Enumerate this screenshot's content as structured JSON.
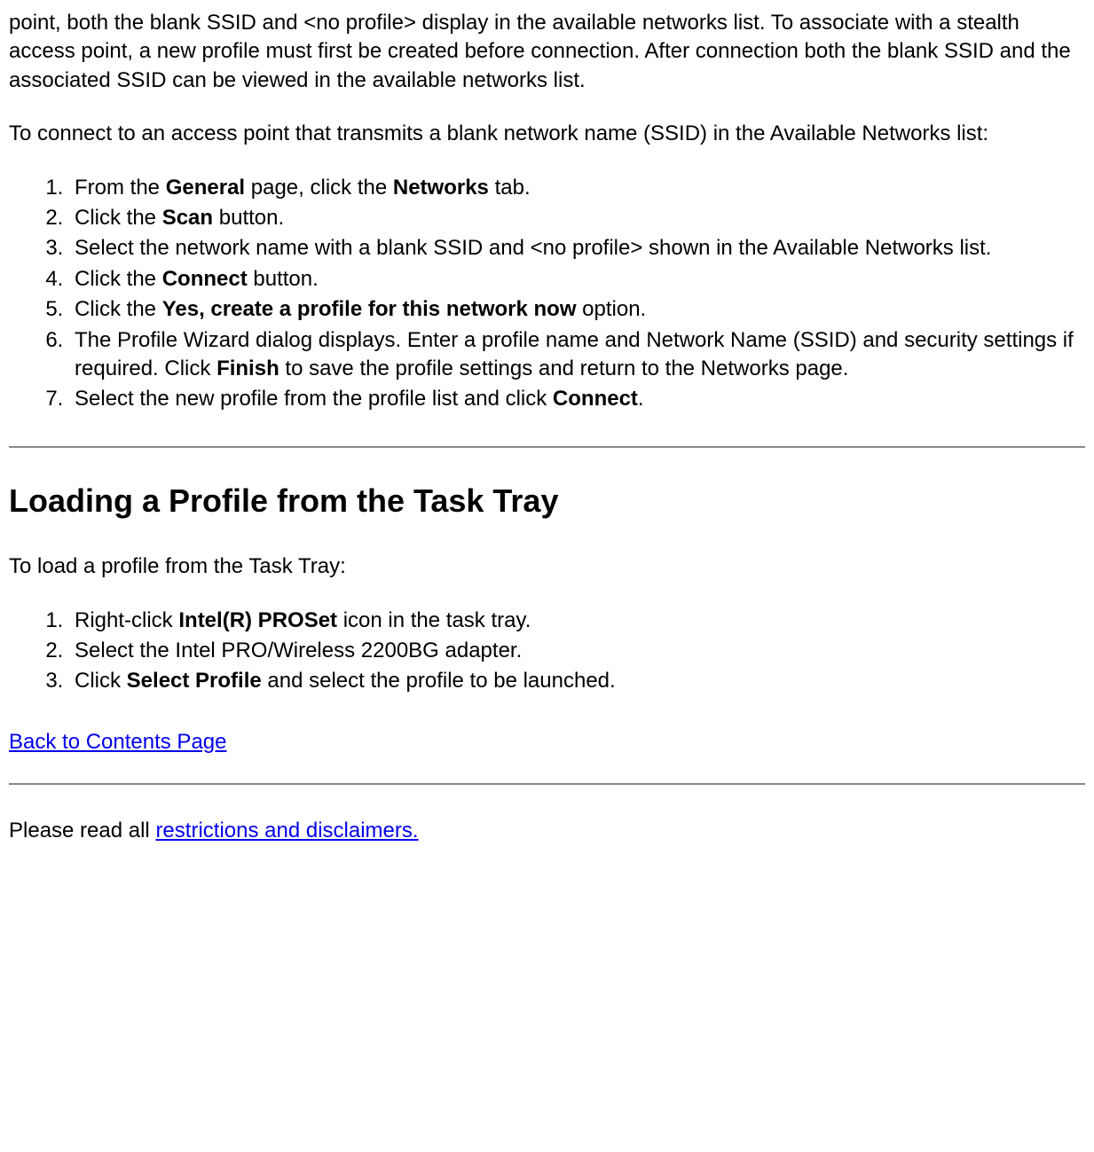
{
  "intro1": "point, both the blank SSID and <no profile> display in the available networks list. To associate with a stealth access point, a new profile must first be created before connection. After connection both the blank SSID and the associated SSID can be viewed in the available networks list.",
  "intro2": "To connect to an access point that transmits a blank network name (SSID) in the Available Networks list:",
  "list1": {
    "i1a": "From the ",
    "i1b": "General",
    "i1c": " page, click the ",
    "i1d": "Networks",
    "i1e": " tab.",
    "i2a": "Click the ",
    "i2b": "Scan",
    "i2c": " button.",
    "i3": "Select the network name with a blank SSID and <no profile> shown in the Available Networks list.",
    "i4a": "Click the ",
    "i4b": "Connect",
    "i4c": " button.",
    "i5a": "Click the ",
    "i5b": "Yes, create a profile for this network now",
    "i5c": " option.",
    "i6a": "The Profile Wizard dialog displays. Enter a profile name and Network Name (SSID) and security settings if required. Click ",
    "i6b": "Finish",
    "i6c": " to save the profile settings and return to the Networks page.",
    "i7a": "Select the new profile from the profile list and click ",
    "i7b": "Connect",
    "i7c": "."
  },
  "heading2": "Loading a Profile from the Task Tray",
  "intro3": "To load a profile from the Task Tray:",
  "list2": {
    "i1a": "Right-click ",
    "i1b": "Intel(R) PROSet",
    "i1c": " icon in the task tray.",
    "i2": "Select the Intel PRO/Wireless 2200BG adapter.",
    "i3a": "Click ",
    "i3b": "Select Profile",
    "i3c": " and select the profile to be launched."
  },
  "backlink": "Back to Contents Page",
  "footer_a": "Please read all ",
  "footer_link": "restrictions and disclaimers."
}
